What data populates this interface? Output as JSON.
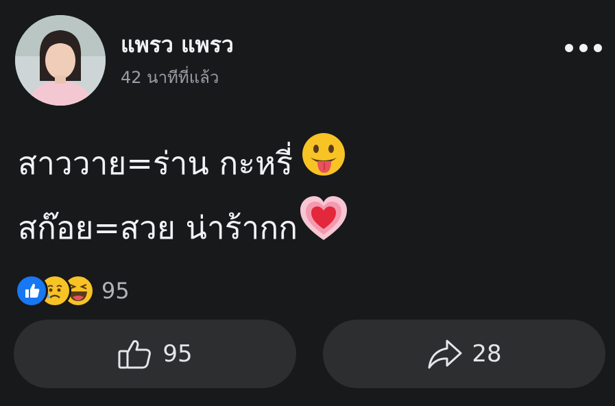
{
  "post": {
    "author_name": "แพรว แพรว",
    "time": "42 นาทีที่แล้ว",
    "text_line1": "สาววาย=ร่าน กะหรี่",
    "text_line2": "สก๊อย=สวย น่าร้ากก",
    "emoji_line1": "grinning-tongue-emoji",
    "emoji_line2": "growing-heart-emoji"
  },
  "reactions": {
    "icons": [
      "like-icon",
      "sad-icon",
      "haha-icon"
    ],
    "count": "95"
  },
  "actions": {
    "like_count": "95",
    "share_count": "28"
  },
  "colors": {
    "background": "#18191b",
    "button_bg": "#2d2e30",
    "like_blue": "#1877f2",
    "emoji_yellow": "#f7c325"
  }
}
